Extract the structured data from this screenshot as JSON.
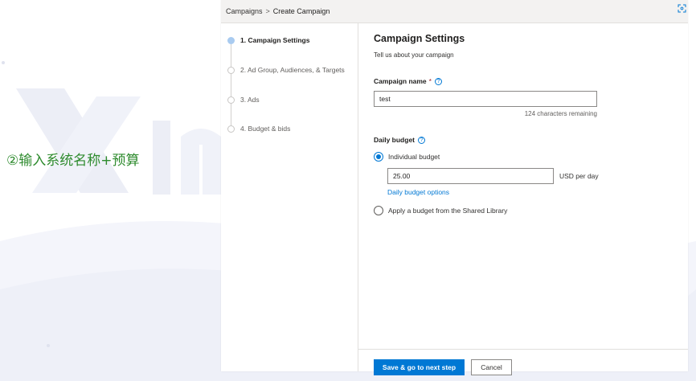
{
  "annotation": "②输入系统名称+预算",
  "breadcrumb": {
    "root": "Campaigns",
    "separator": ">",
    "current": "Create Campaign"
  },
  "steps": [
    {
      "label": "1. Campaign Settings",
      "active": true
    },
    {
      "label": "2. Ad Group, Audiences, & Targets",
      "active": false
    },
    {
      "label": "3. Ads",
      "active": false
    },
    {
      "label": "4. Budget & bids",
      "active": false
    }
  ],
  "main": {
    "title": "Campaign Settings",
    "subtitle": "Tell us about your campaign",
    "campaign_name": {
      "label": "Campaign name",
      "required_mark": "*",
      "help_icon": "?",
      "value": "test",
      "chars_remaining": "124 characters remaining"
    },
    "daily_budget": {
      "label": "Daily budget",
      "help_icon": "?",
      "individual_label": "Individual budget",
      "amount": "25.00",
      "unit": "USD  per day",
      "options_link": "Daily budget options",
      "shared_label": "Apply a budget from the Shared Library"
    }
  },
  "footer": {
    "save_label": "Save & go to next step",
    "cancel_label": "Cancel"
  },
  "colors": {
    "accent": "#0078d4",
    "annotation": "#2e8b2e",
    "active_step_dot": "#a9cbf0"
  },
  "icons": {
    "expand": "expand-icon",
    "help": "help-icon"
  }
}
